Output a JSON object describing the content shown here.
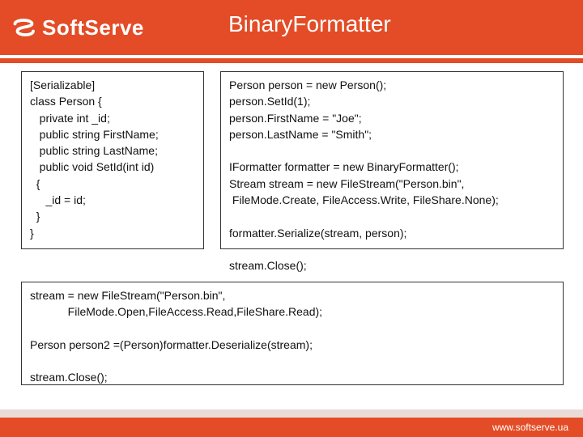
{
  "header": {
    "brand": "SoftServe",
    "title": "BinaryFormatter"
  },
  "code": {
    "left": "[Serializable]\nclass Person {\n   private int _id;\n   public string FirstName;\n   public string LastName;\n   public void SetId(int id)\n  {\n     _id = id;\n  }\n}",
    "right": "Person person = new Person();\nperson.SetId(1);\nperson.FirstName = \"Joe\";\nperson.LastName = \"Smith\";\n\nIFormatter formatter = new BinaryFormatter();\nStream stream = new FileStream(\"Person.bin\",\n FileMode.Create, FileAccess.Write, FileShare.None);\n\nformatter.Serialize(stream, person);\n\nstream.Close();",
    "bottom": "stream = new FileStream(\"Person.bin\",\n            FileMode.Open,FileAccess.Read,FileShare.Read);\n\nPerson person2 =(Person)formatter.Deserialize(stream);\n\nstream.Close();"
  },
  "footer": {
    "url": "www.softserve.ua"
  }
}
